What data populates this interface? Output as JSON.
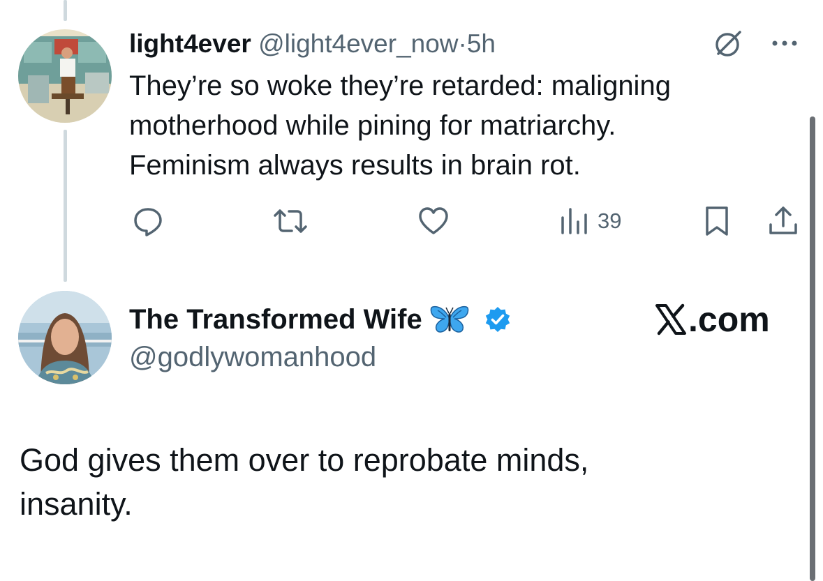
{
  "reply_tweet": {
    "display_name": "light4ever",
    "handle": "@light4ever_now",
    "separator": "·",
    "time": "5h",
    "text_lines": [
      "They’re so woke they’re retarded: maligning",
      "motherhood while pining for matriarchy.",
      "Feminism always results in brain rot."
    ],
    "icons": {
      "header": [
        "grok-icon",
        "more-icon"
      ],
      "actions": [
        "reply-icon",
        "retweet-icon",
        "like-icon",
        "views-icon",
        "bookmark-icon",
        "share-icon"
      ]
    },
    "views_count": "39"
  },
  "main_tweet": {
    "display_name": "The Transformed Wife",
    "name_emoji": "butterfly-icon",
    "verified_badge": "verified-badge-icon",
    "handle": "@godlywomanhood",
    "text_lines": [
      "God gives them over to reprobate minds,",
      "insanity."
    ]
  },
  "watermark": {
    "logo": "x-logo-icon",
    "suffix": ".com"
  },
  "colors": {
    "text": "#0f1419",
    "muted": "#536471",
    "thread_line": "#cfd9de",
    "verified_blue": "#1d9bf0",
    "butterfly_blue": "#3ea7ef"
  }
}
